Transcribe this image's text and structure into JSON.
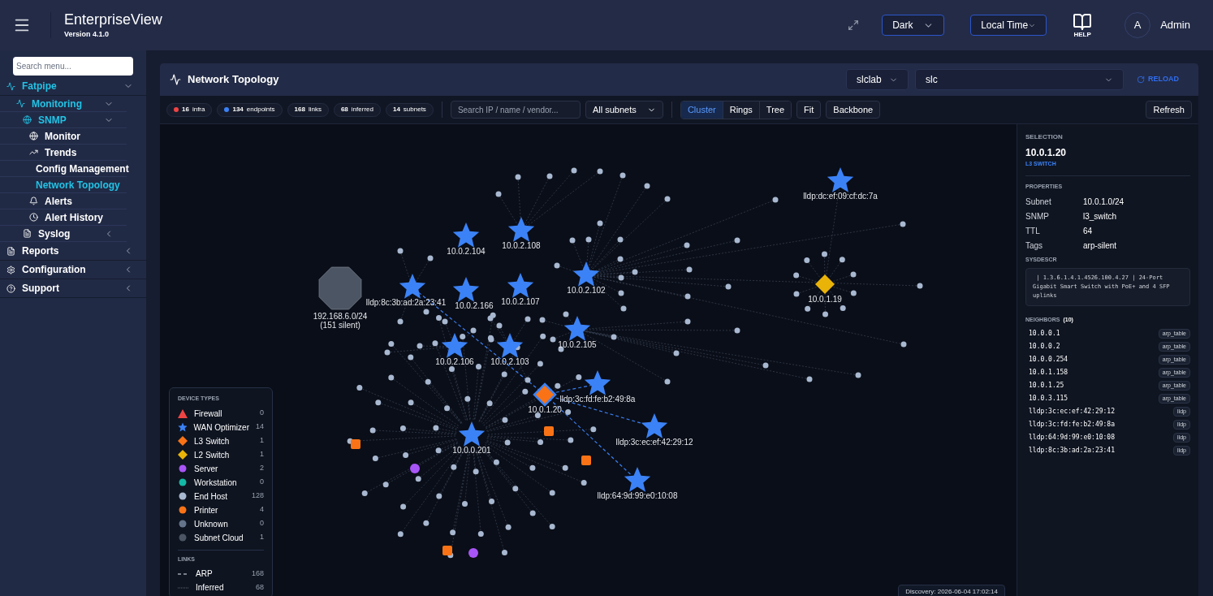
{
  "app": {
    "title": "EnterpriseView",
    "version": "Version 4.1.0"
  },
  "header": {
    "theme": "Dark",
    "time_zone": "Local Time",
    "help_label": "HELP",
    "avatar": "A",
    "user": "Admin"
  },
  "sidebar": {
    "search_placeholder": "Search menu...",
    "items": [
      {
        "label": "Fatpipe",
        "expanded": true,
        "children": [
          {
            "label": "Monitoring",
            "expanded": true,
            "children": [
              {
                "label": "SNMP",
                "expanded": true,
                "children": [
                  {
                    "label": "Monitor",
                    "selected": false
                  },
                  {
                    "label": "Trends",
                    "selected": false
                  },
                  {
                    "label": "Config Management",
                    "selected": false
                  },
                  {
                    "label": "Network Topology",
                    "selected": true
                  },
                  {
                    "label": "Alerts",
                    "selected": false
                  },
                  {
                    "label": "Alert History",
                    "selected": false
                  }
                ]
              },
              {
                "label": "Syslog",
                "expanded": false
              }
            ]
          }
        ]
      },
      {
        "label": "Reports",
        "expanded": false
      },
      {
        "label": "Configuration",
        "expanded": false
      },
      {
        "label": "Support",
        "expanded": false
      }
    ]
  },
  "panel": {
    "title": "Network Topology",
    "site": "slclab",
    "location": "slc",
    "reload": "RELOAD"
  },
  "toolbar": {
    "stats": [
      {
        "count": "16",
        "label": "infra",
        "color": "#ef4444"
      },
      {
        "count": "134",
        "label": "endpoints",
        "color": "#3b82f6"
      },
      {
        "count": "168",
        "label": "links"
      },
      {
        "count": "68",
        "label": "inferred"
      },
      {
        "count": "14",
        "label": "subnets"
      }
    ],
    "search_placeholder": "Search IP / name / vendor...",
    "subnet_filter": "All subnets",
    "views": [
      {
        "label": "Cluster",
        "selected": true
      },
      {
        "label": "Rings",
        "selected": false
      },
      {
        "label": "Tree",
        "selected": false
      }
    ],
    "buttons": [
      "Fit",
      "Backbone"
    ],
    "refresh": "Refresh"
  },
  "graph": {
    "nodes": [
      {
        "kind": "cloud",
        "label": "192.168.6.0/24",
        "sublabel": "(151 silent)",
        "selected": false
      },
      {
        "kind": "star",
        "label": "10.0.2.104",
        "selected": false
      },
      {
        "kind": "star",
        "label": "10.0.2.108",
        "selected": false
      },
      {
        "kind": "star",
        "label": "lldp:8c:3b:ad:2a:23:41",
        "selected": false
      },
      {
        "kind": "star",
        "label": "10.0.2.166",
        "selected": false
      },
      {
        "kind": "star",
        "label": "10.0.2.107",
        "selected": false
      },
      {
        "kind": "star",
        "label": "10.0.2.102",
        "selected": false
      },
      {
        "kind": "star",
        "label": "10.0.2.106",
        "selected": false
      },
      {
        "kind": "star",
        "label": "10.0.2.103",
        "selected": false
      },
      {
        "kind": "star",
        "label": "10.0.2.105",
        "selected": false
      },
      {
        "kind": "star",
        "label": "lldp:3c:fd:fe:b2:49:8a",
        "selected": false
      },
      {
        "kind": "star",
        "label": "lldp:3c:ec:ef:42:29:12",
        "selected": false
      },
      {
        "kind": "star",
        "label": "10.0.0.201",
        "selected": false
      },
      {
        "kind": "star",
        "label": "lldp:64:9d:99:e0:10:08",
        "selected": false
      },
      {
        "kind": "star",
        "label": "lldp:dc:ef:09:cf:dc:7a",
        "selected": false
      },
      {
        "kind": "l3",
        "label": "10.0.1.20",
        "selected": true
      },
      {
        "kind": "l2",
        "label": "10.0.1.19",
        "selected": false
      }
    ],
    "discovery": "Discovery: 2026-06-04 17:02:14"
  },
  "legend": {
    "title": "DEVICE TYPES",
    "types": [
      {
        "kind": "triangle",
        "label": "Firewall",
        "count": "0",
        "color": "#ef4444"
      },
      {
        "kind": "star",
        "label": "WAN Optimizer",
        "count": "14",
        "color": "#3b82f6"
      },
      {
        "kind": "diamond",
        "label": "L3 Switch",
        "count": "1",
        "color": "#f97316"
      },
      {
        "kind": "diamond",
        "label": "L2 Switch",
        "count": "1",
        "color": "#eab308"
      },
      {
        "kind": "dot",
        "label": "Server",
        "count": "2",
        "color": "#a855f7"
      },
      {
        "kind": "dot",
        "label": "Workstation",
        "count": "0",
        "color": "#14b8a6"
      },
      {
        "kind": "dot",
        "label": "End Host",
        "count": "128",
        "color": "#a8b8d0"
      },
      {
        "kind": "dot",
        "label": "Printer",
        "count": "4",
        "color": "#f97316"
      },
      {
        "kind": "dot",
        "label": "Unknown",
        "count": "0",
        "color": "#64748b"
      },
      {
        "kind": "dot",
        "label": "Subnet Cloud",
        "count": "1",
        "color": "#4b5563"
      }
    ],
    "links_title": "LINKS",
    "links": [
      {
        "kind": "dashed",
        "label": "ARP",
        "count": "168"
      },
      {
        "kind": "dotted",
        "label": "Inferred",
        "count": "68"
      }
    ]
  },
  "selection": {
    "heading": "SELECTION",
    "name": "10.0.1.20",
    "type": "L3 SWITCH",
    "properties_heading": "PROPERTIES",
    "properties": [
      {
        "key": "Subnet",
        "value": "10.0.1.0/24"
      },
      {
        "key": "SNMP",
        "value": "l3_switch"
      },
      {
        "key": "TTL",
        "value": "64"
      },
      {
        "key": "Tags",
        "value": "arp-silent"
      }
    ],
    "sysdescr_heading": "SYSDESCR",
    "sysdescr": " | 1.3.6.1.4.1.4526.100.4.27 | 24-Port Gigabit Smart Switch with PoE+ and 4 SFP uplinks",
    "neighbors_heading": "NEIGHBORS",
    "neighbors_count": "(10)",
    "neighbors": [
      {
        "address": "10.0.0.1",
        "source": "arp_table"
      },
      {
        "address": "10.0.0.2",
        "source": "arp_table"
      },
      {
        "address": "10.0.0.254",
        "source": "arp_table"
      },
      {
        "address": "10.0.1.158",
        "source": "arp_table"
      },
      {
        "address": "10.0.1.25",
        "source": "arp_table"
      },
      {
        "address": "10.0.3.115",
        "source": "arp_table"
      },
      {
        "address": "lldp:3c:ec:ef:42:29:12",
        "source": "lldp"
      },
      {
        "address": "lldp:3c:fd:fe:b2:49:8a",
        "source": "lldp"
      },
      {
        "address": "lldp:64:9d:99:e0:10:08",
        "source": "lldp"
      },
      {
        "address": "lldp:8c:3b:ad:2a:23:41",
        "source": "lldp"
      }
    ]
  }
}
